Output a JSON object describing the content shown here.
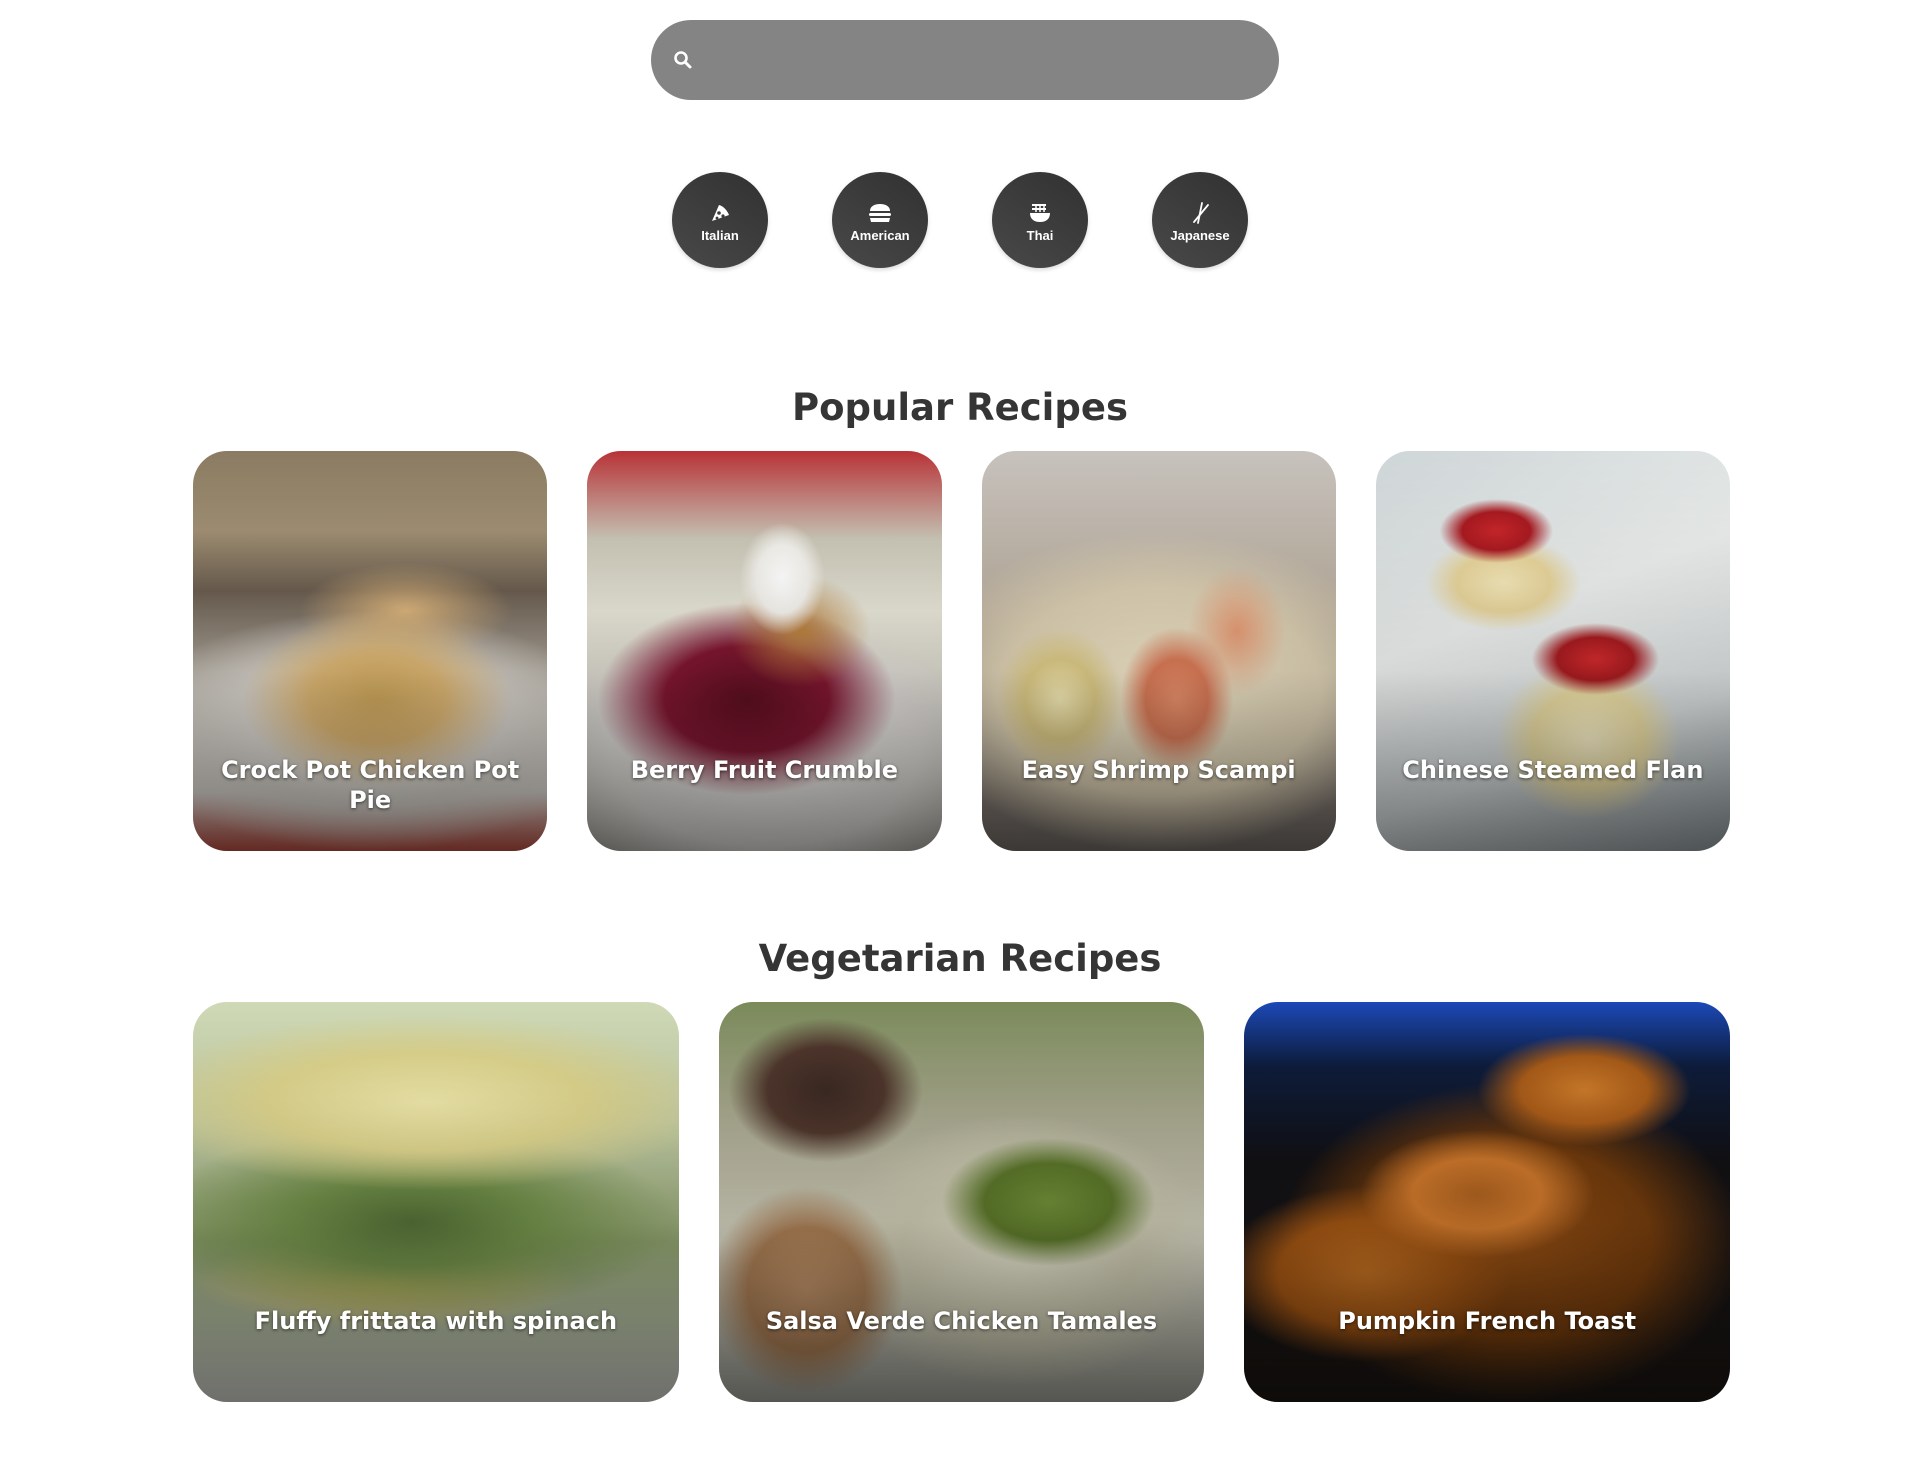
{
  "search": {
    "placeholder": "",
    "value": "",
    "icon": "search-icon"
  },
  "cuisines": [
    {
      "label": "Italian",
      "icon": "pizza-icon"
    },
    {
      "label": "American",
      "icon": "burger-icon"
    },
    {
      "label": "Thai",
      "icon": "noodle-bowl-icon"
    },
    {
      "label": "Japanese",
      "icon": "chopsticks-icon"
    }
  ],
  "popular": {
    "title": "Popular Recipes",
    "recipes": [
      {
        "title": "Crock Pot Chicken Pot Pie"
      },
      {
        "title": "Berry Fruit Crumble"
      },
      {
        "title": "Easy Shrimp Scampi"
      },
      {
        "title": "Chinese Steamed Flan"
      }
    ]
  },
  "vegetarian": {
    "title": "Vegetarian Recipes",
    "recipes": [
      {
        "title": "Fluffy frittata with spinach"
      },
      {
        "title": "Salsa Verde Chicken Tamales"
      },
      {
        "title": "Pumpkin French Toast"
      }
    ]
  },
  "colors": {
    "search_bg": "#848484",
    "cuisine_bg": "#3b3b3b",
    "heading": "#353535"
  }
}
